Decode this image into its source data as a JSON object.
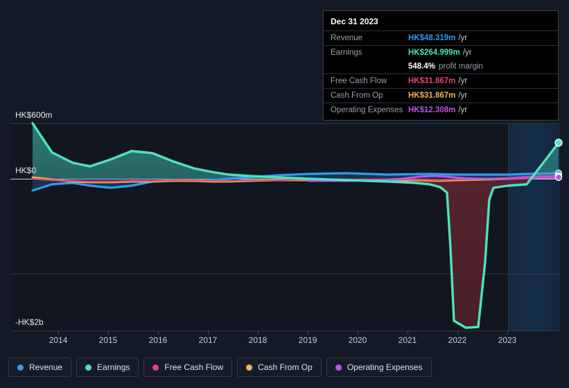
{
  "chart_data": {
    "type": "area",
    "title": "",
    "xlabel": "",
    "ylabel": "",
    "currency": "HK$",
    "grid": true,
    "legend_position": "bottom-left",
    "x_tick_labels": [
      "2014",
      "2015",
      "2016",
      "2017",
      "2018",
      "2019",
      "2020",
      "2021",
      "2022",
      "2023"
    ],
    "y_tick_labels": [
      "HK$600m",
      "HK$0",
      "-HK$2b"
    ],
    "ylim": [
      -2000,
      600
    ],
    "y_axis_values": [
      600,
      0,
      -2000
    ],
    "forecast_region_start": "2023",
    "series": [
      {
        "name": "Revenue",
        "color": "#2d9cf0",
        "values": [
          -60,
          -40,
          -20,
          -55,
          -70,
          -45,
          10,
          20,
          18,
          25,
          30,
          22,
          15,
          20,
          28,
          35,
          48.319
        ]
      },
      {
        "name": "Earnings",
        "color": "#4ee3bd",
        "values": [
          600,
          330,
          245,
          230,
          265,
          300,
          290,
          250,
          200,
          150,
          120,
          95,
          -120,
          -1980,
          -1980,
          -90,
          264.999
        ]
      },
      {
        "name": "Free Cash Flow",
        "color": "#e0457b",
        "values": [
          -5,
          -8,
          -10,
          -12,
          -9,
          -7,
          -5,
          -4,
          -3,
          -6,
          -8,
          -5,
          -4,
          -3,
          -2,
          10,
          31.867
        ]
      },
      {
        "name": "Cash From Op",
        "color": "#f0b552",
        "values": [
          -2,
          -6,
          -12,
          -14,
          -13,
          -11,
          -9,
          -8,
          -7,
          -9,
          -11,
          -8,
          -6,
          -5,
          -4,
          12,
          31.867
        ]
      },
      {
        "name": "Operating Expenses",
        "color": "#bb57e8",
        "values": [
          null,
          null,
          null,
          null,
          null,
          null,
          null,
          null,
          5,
          8,
          12,
          20,
          26,
          18,
          14,
          13,
          12.308
        ]
      }
    ]
  },
  "tooltip": {
    "title": "Dec 31 2023",
    "rows": [
      {
        "label": "Revenue",
        "value": "HK$48.319m",
        "unit": "/yr",
        "color": "#2d9cf0"
      },
      {
        "label": "Earnings",
        "value": "HK$264.999m",
        "unit": "/yr",
        "color": "#4ee3bd"
      },
      {
        "label": "Free Cash Flow",
        "value": "HK$31.867m",
        "unit": "/yr",
        "color": "#e0457b"
      },
      {
        "label": "Cash From Op",
        "value": "HK$31.867m",
        "unit": "/yr",
        "color": "#f0b552"
      },
      {
        "label": "Operating Expenses",
        "value": "HK$12.308m",
        "unit": "/yr",
        "color": "#bb57e8"
      }
    ],
    "margin_value": "548.4%",
    "margin_label": "profit margin"
  },
  "legend": {
    "items": [
      {
        "label": "Revenue",
        "color": "#2d9cf0"
      },
      {
        "label": "Earnings",
        "color": "#4ee3bd"
      },
      {
        "label": "Free Cash Flow",
        "color": "#e0457b"
      },
      {
        "label": "Cash From Op",
        "color": "#f0b552"
      },
      {
        "label": "Operating Expenses",
        "color": "#bb57e8"
      }
    ]
  },
  "axis": {
    "y_top": "HK$600m",
    "y_zero": "HK$0",
    "y_bottom": "-HK$2b",
    "x": [
      "2014",
      "2015",
      "2016",
      "2017",
      "2018",
      "2019",
      "2020",
      "2021",
      "2022",
      "2023"
    ]
  }
}
